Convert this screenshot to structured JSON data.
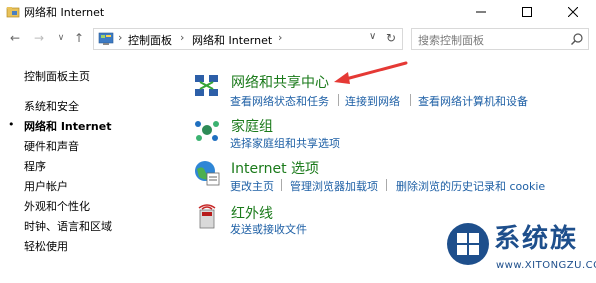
{
  "window": {
    "title": "网络和 Internet",
    "min_label": "—",
    "max_label": "☐",
    "close_label": "✕"
  },
  "nav": {
    "back": "←",
    "forward": "→",
    "recent": "∨",
    "up": "↑"
  },
  "address": {
    "crumbs": [
      "控制面板",
      "网络和 Internet"
    ],
    "separator": "›",
    "dropdown": "∨",
    "refresh": "↻"
  },
  "search": {
    "placeholder": "搜索控制面板"
  },
  "sidebar": {
    "items": [
      {
        "label": "控制面板主页",
        "active": false
      },
      {
        "label": "系统和安全",
        "active": false
      },
      {
        "label": "网络和 Internet",
        "active": true
      },
      {
        "label": "硬件和声音",
        "active": false
      },
      {
        "label": "程序",
        "active": false
      },
      {
        "label": "用户帐户",
        "active": false
      },
      {
        "label": "外观和个性化",
        "active": false
      },
      {
        "label": "时钟、语言和区域",
        "active": false
      },
      {
        "label": "轻松使用",
        "active": false
      }
    ]
  },
  "categories": [
    {
      "title": "网络和共享中心",
      "icon": "network-sharing-icon",
      "links": [
        "查看网络状态和任务",
        "连接到网络",
        "查看网络计算机和设备"
      ]
    },
    {
      "title": "家庭组",
      "icon": "homegroup-icon",
      "links": [
        "选择家庭组和共享选项"
      ]
    },
    {
      "title": "Internet 选项",
      "icon": "internet-options-icon",
      "links": [
        "更改主页",
        "管理浏览器加载项",
        "删除浏览的历史记录和 cookie"
      ]
    },
    {
      "title": "红外线",
      "icon": "infrared-icon",
      "links": [
        "发送或接收文件"
      ]
    }
  ],
  "watermark": {
    "title": "系统族",
    "url": "www.XITONGZU.COM"
  },
  "colors": {
    "category_title": "#1a7a1a",
    "link": "#1d5fa5",
    "annotation_arrow": "#e53935",
    "watermark": "#1e4f8c"
  }
}
